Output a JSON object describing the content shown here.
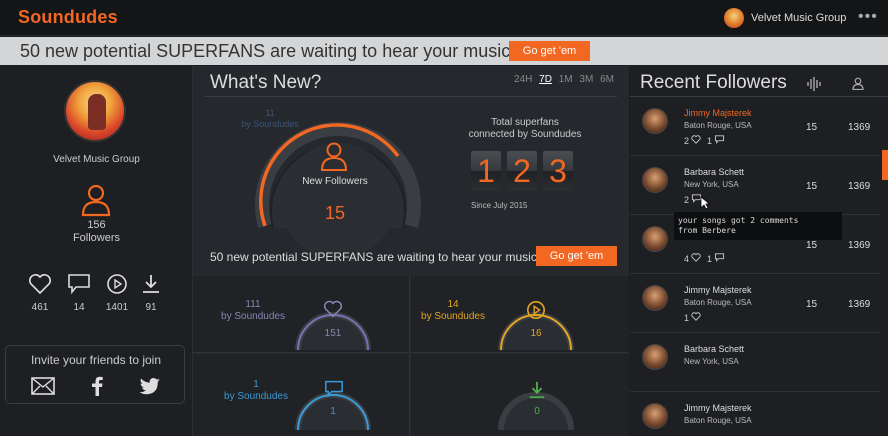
{
  "app": {
    "logo": "Soundudes",
    "user_name": "Velvet Music Group",
    "more": "•••"
  },
  "banner": {
    "text": "50 new potential SUPERFANS are waiting to hear your music",
    "button": "Go get 'em"
  },
  "sidebar": {
    "name": "Velvet Music Group",
    "followers_count": "156",
    "followers_label": "Followers",
    "stats": [
      {
        "icon": "heart-icon",
        "value": "461"
      },
      {
        "icon": "comment-icon",
        "value": "14"
      },
      {
        "icon": "play-icon",
        "value": "1401"
      },
      {
        "icon": "download-icon",
        "value": "91"
      }
    ],
    "invite_title": "Invite your friends to join"
  },
  "whats_new": {
    "title": "What's New?",
    "periods": [
      "24H",
      "7D",
      "1M",
      "3M",
      "6M"
    ],
    "active_period": "7D",
    "gauge": {
      "soundudes_value": "11",
      "soundudes_label": "by Soundudes",
      "label": "New Followers",
      "value": "15"
    },
    "superfans": {
      "title_line1": "Total superfans",
      "title_line2": "connected by Soundudes",
      "digits": [
        "1",
        "2",
        "3"
      ],
      "since": "Since July 2015"
    },
    "banner_text": "50 new potential SUPERFANS are waiting to hear your music",
    "banner_button": "Go get 'em",
    "tiles": [
      {
        "soundudes_value": "111",
        "soundudes_label": "by Soundudes",
        "value": "151",
        "icon": "heart-icon",
        "color": "#7b6fb3"
      },
      {
        "soundudes_value": "14",
        "soundudes_label": "by Soundudes",
        "value": "16",
        "icon": "play-icon",
        "color": "#e3a522"
      },
      {
        "soundudes_value": "1",
        "soundudes_label": "by Soundudes",
        "value": "1",
        "icon": "comment-icon",
        "color": "#3b9ad8"
      },
      {
        "value": "0",
        "icon": "download-icon",
        "color": "#4caf50"
      }
    ]
  },
  "recent_followers": {
    "title": "Recent Followers",
    "rows": [
      {
        "name": "Jimmy Majsterek",
        "location": "Baton Rouge, USA",
        "likes": "2",
        "comments": "1",
        "col1": "15",
        "col2": "1369",
        "highlight": true
      },
      {
        "name": "Barbara Schett",
        "location": "New York, USA",
        "likes": "",
        "comments": "2",
        "col1": "15",
        "col2": "1369"
      },
      {
        "name": "",
        "location": "",
        "likes": "4",
        "comments": "1",
        "col1": "15",
        "col2": "1369"
      },
      {
        "name": "Jimmy Majsterek",
        "location": "Baton Rouge, USA",
        "likes": "1",
        "comments": "",
        "col1": "15",
        "col2": "1369"
      },
      {
        "name": "Barbara Schett",
        "location": "New York, USA",
        "likes": "",
        "comments": "",
        "col1": "",
        "col2": ""
      },
      {
        "name": "Jimmy Majsterek",
        "location": "Baton Rouge, USA",
        "likes": "",
        "comments": "",
        "col1": "",
        "col2": ""
      }
    ]
  },
  "tooltip": {
    "line1": "your songs got 2 comments",
    "line2": "from Berbere"
  },
  "colors": {
    "accent": "#f26722",
    "banner_bg": "#d4d5d7",
    "panel_bg": "#25282c"
  }
}
